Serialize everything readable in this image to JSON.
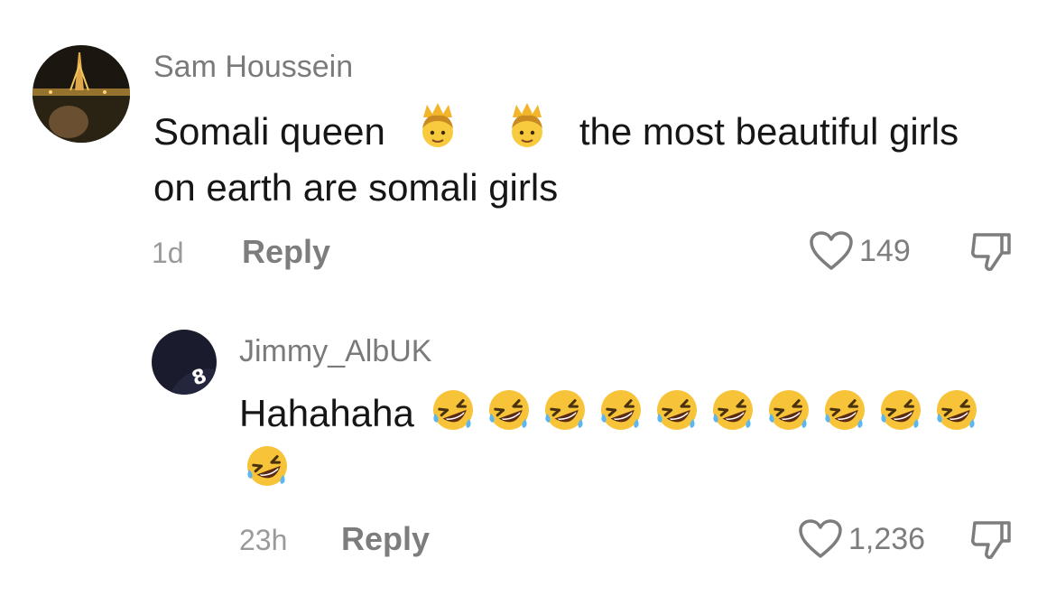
{
  "comments": [
    {
      "username": "Sam Houssein",
      "text_parts": [
        "Somali queen",
        "the most beautiful girls",
        "on earth are somali girls"
      ],
      "emojis": [
        "princess-emoji",
        "princess-emoji"
      ],
      "time": "1d",
      "reply_label": "Reply",
      "likes": "149"
    },
    {
      "username": "Jimmy_AlbUK",
      "text": "Hahahaha",
      "emoji_name": "rolling-on-floor-laughing-emoji",
      "emoji_count": 11,
      "time": "23h",
      "reply_label": "Reply",
      "likes": "1,236"
    }
  ],
  "colors": {
    "secondary_text": "#7d7d7d",
    "primary_text": "#161616",
    "emoji_yellow": "#f7c338"
  }
}
